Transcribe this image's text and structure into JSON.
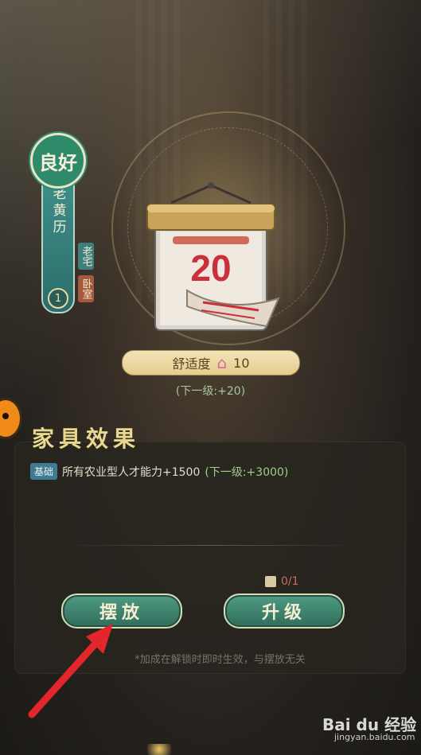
{
  "furniture": {
    "quality": "良好",
    "name": "老黄历",
    "level": "1",
    "locations": [
      "老宅",
      "卧室"
    ],
    "calendar_day": "20"
  },
  "comfort": {
    "label": "舒适度",
    "value": "10",
    "next_level": "(下一级:+20)"
  },
  "effects": {
    "title": "家具效果",
    "base_tag": "基础",
    "description": "所有农业型人才能力+1500",
    "next": "(下一级:+3000)"
  },
  "requirement": {
    "count": "0/1"
  },
  "buttons": {
    "place": "摆放",
    "upgrade": "升级"
  },
  "note": "*加成在解锁时即时生效，与摆放无关",
  "watermark": {
    "brand": "Bai du 经验",
    "url": "jingyan.baidu.com"
  },
  "colors": {
    "accent_green": "#2f8a6a",
    "button_green": "#4f9a82",
    "gold": "#ead88f",
    "red_requirement": "#c96b5a",
    "arrow_red": "#e2262b"
  }
}
